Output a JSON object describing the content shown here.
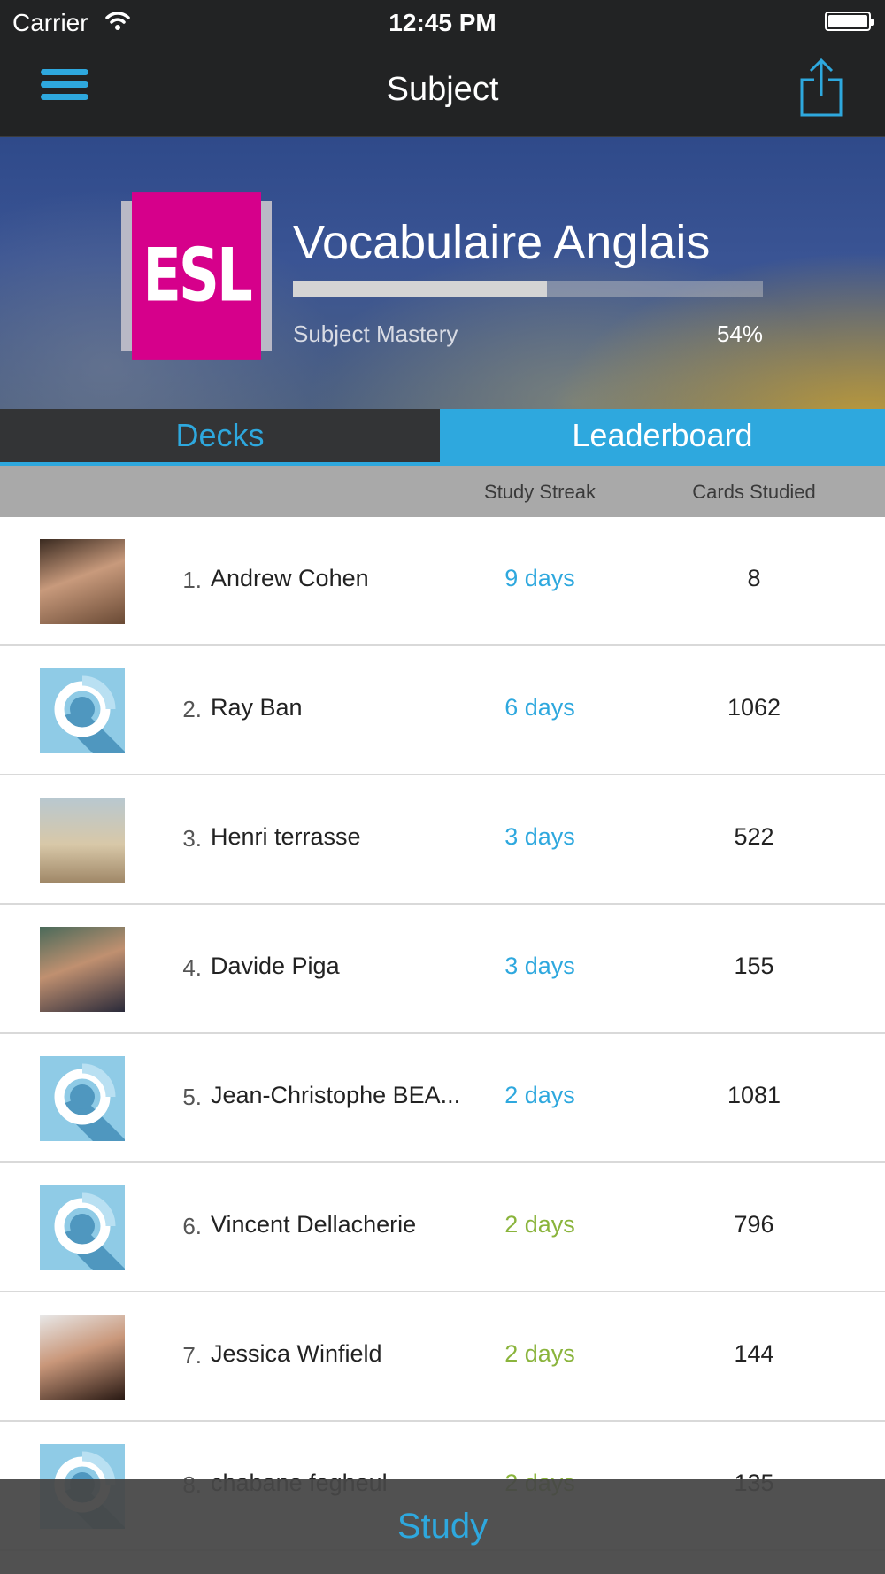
{
  "status_bar": {
    "carrier": "Carrier",
    "time": "12:45 PM"
  },
  "nav": {
    "title": "Subject"
  },
  "subject": {
    "logo_text": "ESL",
    "title": "Vocabulaire Anglais",
    "mastery_label": "Subject Mastery",
    "mastery_percent_text": "54%",
    "mastery_fraction": 0.54
  },
  "tabs": [
    {
      "label": "Decks",
      "active": false
    },
    {
      "label": "Leaderboard",
      "active": true
    }
  ],
  "columns": {
    "streak": "Study Streak",
    "cards": "Cards Studied"
  },
  "colors": {
    "accent": "#2ea8de",
    "streak_blue": "#2ea8de",
    "streak_green": "#8ab43c",
    "logo_magenta": "#d6008b"
  },
  "leaderboard": [
    {
      "rank": "1.",
      "name": "Andrew Cohen",
      "streak": "9 days",
      "cards": "8",
      "avatar": "photo",
      "streak_color": "blue"
    },
    {
      "rank": "2.",
      "name": "Ray Ban",
      "streak": "6 days",
      "cards": "1062",
      "avatar": "default",
      "streak_color": "blue"
    },
    {
      "rank": "3.",
      "name": "Henri  terrasse",
      "streak": "3 days",
      "cards": "522",
      "avatar": "photo",
      "streak_color": "blue"
    },
    {
      "rank": "4.",
      "name": "Davide Piga",
      "streak": "3 days",
      "cards": "155",
      "avatar": "photo",
      "streak_color": "blue"
    },
    {
      "rank": "5.",
      "name": "Jean-Christophe  BEA...",
      "streak": "2 days",
      "cards": "1081",
      "avatar": "default",
      "streak_color": "blue"
    },
    {
      "rank": "6.",
      "name": "Vincent Dellacherie",
      "streak": "2 days",
      "cards": "796",
      "avatar": "default",
      "streak_color": "green"
    },
    {
      "rank": "7.",
      "name": "Jessica Winfield",
      "streak": "2 days",
      "cards": "144",
      "avatar": "photo",
      "streak_color": "green"
    },
    {
      "rank": "8.",
      "name": "chabane fegheul",
      "streak": "2 days",
      "cards": "135",
      "avatar": "default",
      "streak_color": "green"
    }
  ],
  "study_bar": {
    "label": "Study"
  }
}
